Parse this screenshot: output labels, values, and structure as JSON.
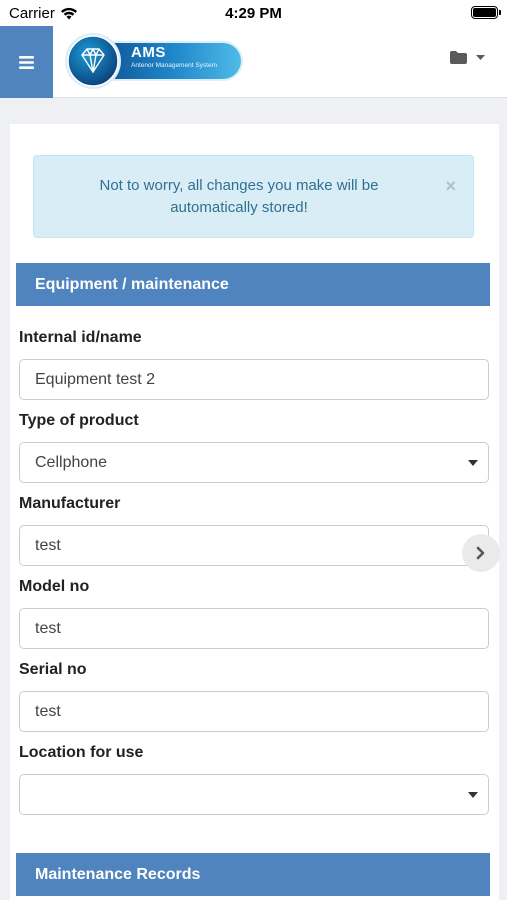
{
  "status_bar": {
    "carrier": "Carrier",
    "time": "4:29 PM"
  },
  "navbar": {
    "logo_title": "AMS",
    "logo_subtitle": "Antenor Management System"
  },
  "alert": {
    "text": "Not to worry, all changes you make will be automatically stored!",
    "close": "×"
  },
  "sections": {
    "equipment": "Equipment / maintenance",
    "maintenance": "Maintenance Records"
  },
  "form": {
    "internal_id": {
      "label": "Internal id/name",
      "value": "Equipment test 2"
    },
    "product_type": {
      "label": "Type of product",
      "value": "Cellphone"
    },
    "manufacturer": {
      "label": "Manufacturer",
      "value": "test"
    },
    "model_no": {
      "label": "Model no",
      "value": "test"
    },
    "serial_no": {
      "label": "Serial no",
      "value": "test"
    },
    "location": {
      "label": "Location for use",
      "value": ""
    }
  },
  "colors": {
    "accent": "#4f84bf",
    "alert_bg": "#d9edf7",
    "alert_text": "#31708f"
  },
  "icons": [
    "wifi-icon",
    "battery-icon",
    "hamburger-menu-icon",
    "diamond-logo-icon",
    "folder-icon",
    "caret-down-icon",
    "chevron-right-icon",
    "close-icon"
  ]
}
